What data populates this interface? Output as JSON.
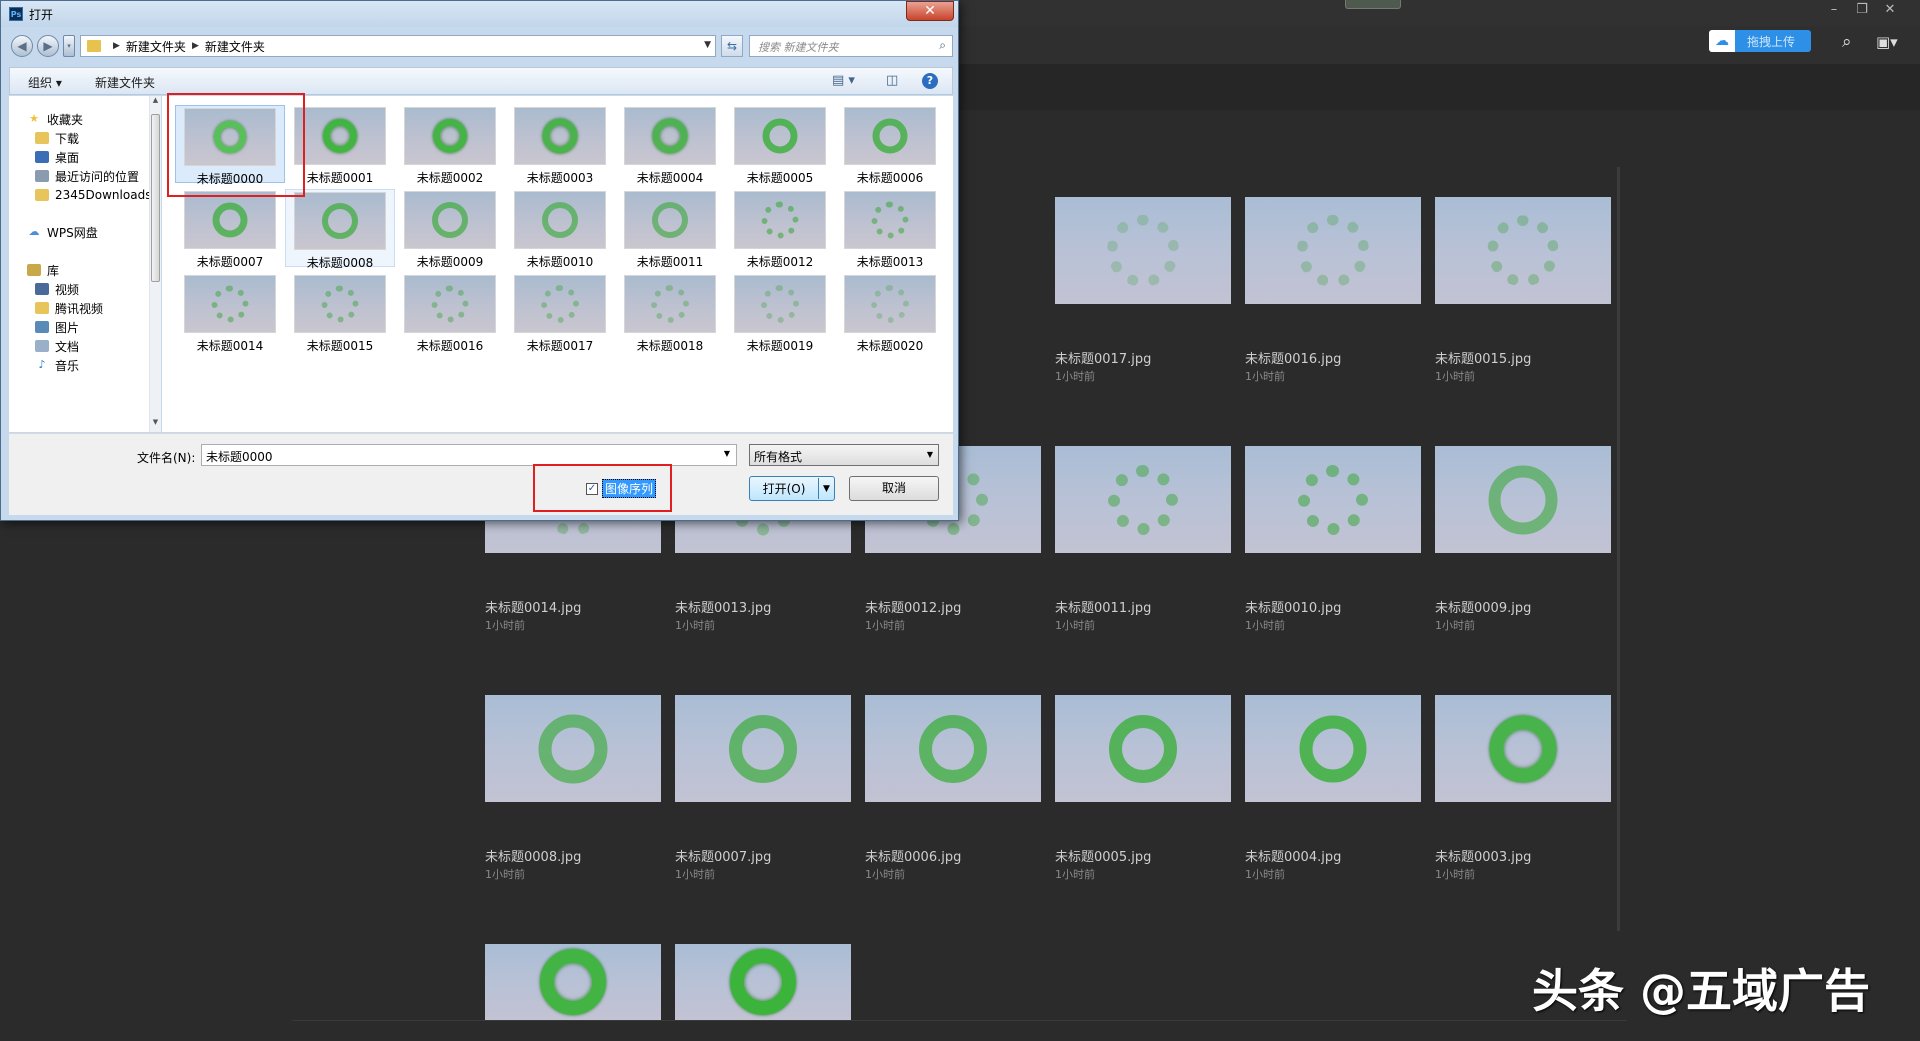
{
  "app": {
    "upload_label": "拖拽上传",
    "colors": {
      "background": "#2b2b2b",
      "upload_accent": "#2e8fe6"
    },
    "icons": [
      "search-icon",
      "panel-icon",
      "gear-icon",
      "help-icon",
      "user-avatar-icon"
    ]
  },
  "recent_files": [
    {
      "name": "未标题0017.jpg",
      "time": "1小时前",
      "density": 0.25
    },
    {
      "name": "未标题0016.jpg",
      "time": "1小时前",
      "density": 0.3
    },
    {
      "name": "未标题0015.jpg",
      "time": "1小时前",
      "density": 0.35
    },
    {
      "name": "未标题0014.jpg",
      "time": "1小时前",
      "density": 0.35
    },
    {
      "name": "未标题0013.jpg",
      "time": "1小时前",
      "density": 0.4
    },
    {
      "name": "未标题0012.jpg",
      "time": "1小时前",
      "density": 0.45
    },
    {
      "name": "未标题0011.jpg",
      "time": "1小时前",
      "density": 0.5
    },
    {
      "name": "未标题0010.jpg",
      "time": "1小时前",
      "density": 0.55
    },
    {
      "name": "未标题0009.jpg",
      "time": "1小时前",
      "density": 0.6
    },
    {
      "name": "未标题0008.jpg",
      "time": "1小时前",
      "density": 0.65
    },
    {
      "name": "未标题0007.jpg",
      "time": "1小时前",
      "density": 0.7
    },
    {
      "name": "未标题0006.jpg",
      "time": "1小时前",
      "density": 0.75
    },
    {
      "name": "未标题0005.jpg",
      "time": "1小时前",
      "density": 0.8
    },
    {
      "name": "未标题0004.jpg",
      "time": "1小时前",
      "density": 0.85
    },
    {
      "name": "未标题0003.jpg",
      "time": "1小时前",
      "density": 0.9
    },
    {
      "name": "",
      "time": "",
      "density": 0.95
    },
    {
      "name": "",
      "time": "",
      "density": 1.0
    }
  ],
  "dialog": {
    "title": "打开",
    "close_label": "✕",
    "breadcrumb": [
      "新建文件夹",
      "新建文件夹"
    ],
    "search_placeholder": "搜索 新建文件夹",
    "toolbar": {
      "organize": "组织 ▾",
      "new_folder": "新建文件夹"
    },
    "nav": [
      {
        "label": "收藏夹",
        "icon": "star-icon",
        "indent": 0
      },
      {
        "label": "下载",
        "icon": "download-folder-icon",
        "indent": 1
      },
      {
        "label": "桌面",
        "icon": "desktop-icon",
        "indent": 1
      },
      {
        "label": "最近访问的位置",
        "icon": "recent-places-icon",
        "indent": 1
      },
      {
        "label": "2345Downloads",
        "icon": "folder-icon",
        "indent": 1
      },
      {
        "label": "",
        "icon": "",
        "indent": 0
      },
      {
        "label": "WPS网盘",
        "icon": "cloud-drive-icon",
        "indent": 0
      },
      {
        "label": "",
        "icon": "",
        "indent": 0
      },
      {
        "label": "库",
        "icon": "library-icon",
        "indent": 0
      },
      {
        "label": "视频",
        "icon": "video-icon",
        "indent": 1
      },
      {
        "label": "腾讯视频",
        "icon": "folder-icon",
        "indent": 1
      },
      {
        "label": "图片",
        "icon": "pictures-icon",
        "indent": 1
      },
      {
        "label": "文档",
        "icon": "documents-icon",
        "indent": 1
      },
      {
        "label": "音乐",
        "icon": "music-icon",
        "indent": 1
      }
    ],
    "files": [
      "未标题0000",
      "未标题0001",
      "未标题0002",
      "未标题0003",
      "未标题0004",
      "未标题0005",
      "未标题0006",
      "未标题0007",
      "未标题0008",
      "未标题0009",
      "未标题0010",
      "未标题0011",
      "未标题0012",
      "未标题0013",
      "未标题0014",
      "未标题0015",
      "未标题0016",
      "未标题0017",
      "未标题0018",
      "未标题0019",
      "未标题0020"
    ],
    "selected_file": "未标题0000",
    "filename_label": "文件名(N):",
    "filename_value": "未标题0000",
    "format_value": "所有格式",
    "sequence_label": "图像序列",
    "sequence_checked": true,
    "open_label": "打开(O)",
    "cancel_label": "取消"
  },
  "watermark": "头条 @五域广告"
}
